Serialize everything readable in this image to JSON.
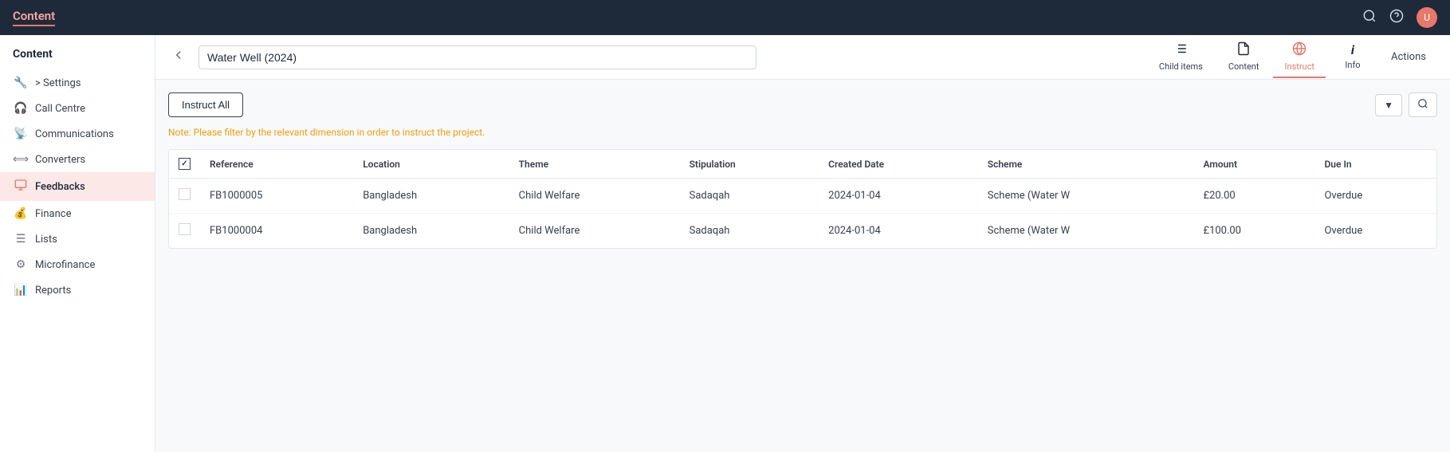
{
  "app": {
    "title": "Content",
    "nav_icons": [
      "search",
      "help",
      "avatar"
    ],
    "avatar_initials": "U"
  },
  "sidebar": {
    "header": "Content",
    "items": [
      {
        "id": "settings",
        "label": "> Settings",
        "icon": "🔧",
        "active": false
      },
      {
        "id": "call-centre",
        "label": "Call Centre",
        "icon": "🎧",
        "active": false
      },
      {
        "id": "communications",
        "label": "Communications",
        "icon": "📡",
        "active": false
      },
      {
        "id": "converters",
        "label": "Converters",
        "icon": "⟺",
        "active": false
      },
      {
        "id": "feedbacks",
        "label": "Feedbacks",
        "icon": "📋",
        "active": true
      },
      {
        "id": "finance",
        "label": "Finance",
        "icon": "💰",
        "active": false
      },
      {
        "id": "lists",
        "label": "Lists",
        "icon": "☰",
        "active": false
      },
      {
        "id": "microfinance",
        "label": "Microfinance",
        "icon": "⚙",
        "active": false
      },
      {
        "id": "reports",
        "label": "Reports",
        "icon": "📊",
        "active": false
      }
    ]
  },
  "content_header": {
    "back_label": "←",
    "title_value": "Water Well (2024)",
    "tabs": [
      {
        "id": "child-items",
        "label": "Child items",
        "icon": "≡",
        "active": false
      },
      {
        "id": "content",
        "label": "Content",
        "icon": "☐",
        "active": false
      },
      {
        "id": "instruct",
        "label": "Instruct",
        "icon": "🌐",
        "active": true
      },
      {
        "id": "info",
        "label": "Info",
        "icon": "i",
        "active": false
      }
    ],
    "actions_label": "Actions"
  },
  "main": {
    "instruct_all_label": "Instruct All",
    "note": "Note: Please filter by the relevant dimension in order to instruct the project.",
    "table": {
      "columns": [
        {
          "id": "checkbox",
          "label": ""
        },
        {
          "id": "reference",
          "label": "Reference"
        },
        {
          "id": "location",
          "label": "Location"
        },
        {
          "id": "theme",
          "label": "Theme"
        },
        {
          "id": "stipulation",
          "label": "Stipulation"
        },
        {
          "id": "created_date",
          "label": "Created Date"
        },
        {
          "id": "scheme",
          "label": "Scheme"
        },
        {
          "id": "amount",
          "label": "Amount"
        },
        {
          "id": "due_in",
          "label": "Due In"
        }
      ],
      "rows": [
        {
          "reference": "FB1000005",
          "location": "Bangladesh",
          "theme": "Child Welfare",
          "stipulation": "Sadaqah",
          "created_date": "2024-01-04",
          "scheme": "Scheme (Water W",
          "amount": "£20.00",
          "due_in": "Overdue"
        },
        {
          "reference": "FB1000004",
          "location": "Bangladesh",
          "theme": "Child Welfare",
          "stipulation": "Sadaqah",
          "created_date": "2024-01-04",
          "scheme": "Scheme (Water W",
          "amount": "£100.00",
          "due_in": "Overdue"
        }
      ]
    }
  },
  "icons": {
    "search": "🔍",
    "help": "?",
    "filter": "▼",
    "search_table": "🔍"
  }
}
